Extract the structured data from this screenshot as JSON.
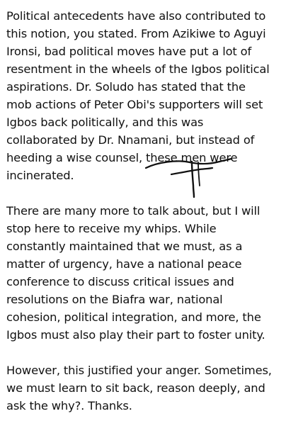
{
  "paragraphs": [
    {
      "lines": [
        "Political antecedents have also contributed to",
        "this notion, you stated. From Azikiwe to Aguyi",
        "Ironsi, bad political moves have put a lot of",
        "resentment in the wheels of the Igbos political",
        "aspirations. Dr. Soludo has stated that the",
        "mob actions of Peter Obi's supporters will set",
        "Igbos back politically, and this was",
        "collaborated by Dr. Nnamani, but instead of",
        "heeding a wise counsel, these men were",
        "incinerated."
      ]
    },
    {
      "lines": [
        "There are many more to talk about, but I will",
        "stop here to receive my whips. While",
        "constantly maintained that we must, as a",
        "matter of urgency, have a national peace",
        "conference to discuss critical issues and",
        "resolutions on the Biafra war, national",
        "cohesion, political integration, and more, the",
        "Igbos must also play their part to foster unity."
      ]
    },
    {
      "lines": [
        "However, this justified your anger. Sometimes,",
        "we must learn to sit back, reason deeply, and",
        "ask the why?. Thanks."
      ]
    }
  ],
  "annotation": {
    "icon": "handwritten-cross-icon",
    "color": "#111111"
  }
}
